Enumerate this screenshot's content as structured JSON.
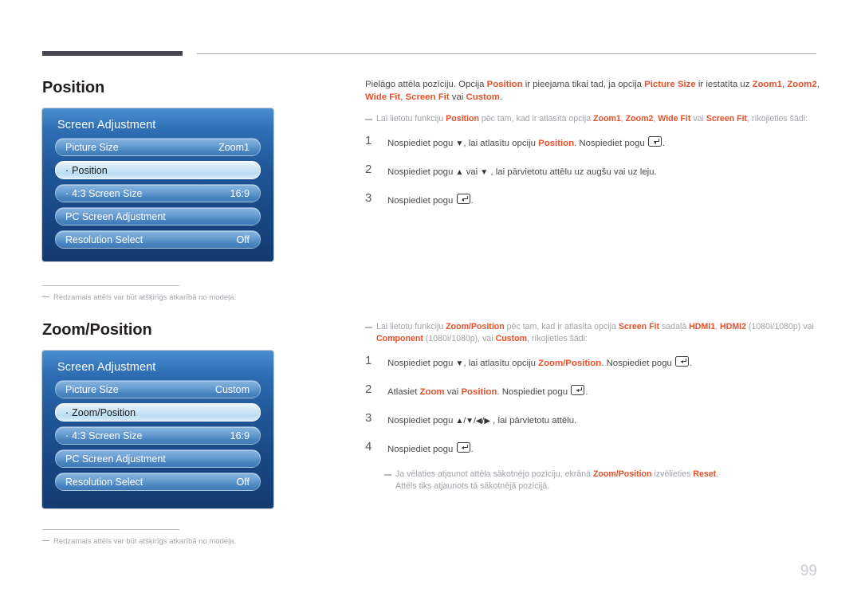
{
  "page": {
    "number": "99"
  },
  "sections": [
    {
      "id": "position",
      "title": "Position",
      "osd": {
        "title": "Screen Adjustment",
        "rows": [
          {
            "label": "Picture Size",
            "value": "Zoom1",
            "selected": false,
            "bullet": false
          },
          {
            "label": "Position",
            "value": "",
            "selected": true,
            "bullet": true
          },
          {
            "label": "4:3 Screen Size",
            "value": "16:9",
            "selected": false,
            "bullet": true
          },
          {
            "label": "PC Screen Adjustment",
            "value": "",
            "selected": false,
            "bullet": false
          },
          {
            "label": "Resolution Select",
            "value": "Off",
            "selected": false,
            "bullet": false
          }
        ]
      },
      "footnote": "Redzamais attēls var būt atšķirīgs atkarībā no modeļa.",
      "intro_parts": [
        {
          "t": "Pielāgo attēla pozīciju. Opcija ",
          "hl": false
        },
        {
          "t": "Position",
          "hl": true
        },
        {
          "t": " ir pieejama tikai tad, ja opcija ",
          "hl": false
        },
        {
          "t": "Picture Size",
          "hl": true
        },
        {
          "t": " ir iestatīta uz ",
          "hl": false
        },
        {
          "t": "Zoom1",
          "hl": true
        },
        {
          "t": ", ",
          "hl": false
        },
        {
          "t": "Zoom2",
          "hl": true
        },
        {
          "t": ", ",
          "hl": false
        },
        {
          "t": "Wide Fit",
          "hl": true
        },
        {
          "t": ", ",
          "hl": false
        },
        {
          "t": "Screen Fit",
          "hl": true
        },
        {
          "t": " vai ",
          "hl": false
        },
        {
          "t": "Custom",
          "hl": true
        },
        {
          "t": ".",
          "hl": false
        }
      ],
      "note_parts": [
        {
          "t": "Lai lietotu funkciju ",
          "hl": false
        },
        {
          "t": "Position",
          "hl": true
        },
        {
          "t": " pēc tam, kad ir atlasīta opcija ",
          "hl": false
        },
        {
          "t": "Zoom1",
          "hl": true
        },
        {
          "t": ", ",
          "hl": false
        },
        {
          "t": "Zoom2",
          "hl": true
        },
        {
          "t": ", ",
          "hl": false
        },
        {
          "t": "Wide Fit",
          "hl": true
        },
        {
          "t": " vai ",
          "hl": false
        },
        {
          "t": "Screen Fit",
          "hl": true
        },
        {
          "t": ", rīkojieties šādi:",
          "hl": false
        }
      ],
      "steps": [
        {
          "num": "1",
          "parts": [
            {
              "t": "Nospiediet pogu ",
              "k": "text"
            },
            {
              "t": "▼",
              "k": "arrow"
            },
            {
              "t": ", lai atlasītu opciju ",
              "k": "text"
            },
            {
              "t": "Position",
              "k": "hl"
            },
            {
              "t": ". Nospiediet pogu ",
              "k": "text"
            },
            {
              "t": "enter-key",
              "k": "enter"
            },
            {
              "t": ".",
              "k": "text"
            }
          ]
        },
        {
          "num": "2",
          "parts": [
            {
              "t": "Nospiediet pogu ",
              "k": "text"
            },
            {
              "t": "▲",
              "k": "arrow"
            },
            {
              "t": " vai ",
              "k": "text"
            },
            {
              "t": "▼",
              "k": "arrow"
            },
            {
              "t": " , lai pārvietotu attēlu uz augšu vai uz leju.",
              "k": "text"
            }
          ]
        },
        {
          "num": "3",
          "parts": [
            {
              "t": "Nospiediet pogu ",
              "k": "text"
            },
            {
              "t": "enter-key",
              "k": "enter"
            },
            {
              "t": ".",
              "k": "text"
            }
          ]
        }
      ]
    },
    {
      "id": "zoom-position",
      "title": "Zoom/Position",
      "osd": {
        "title": "Screen Adjustment",
        "rows": [
          {
            "label": "Picture Size",
            "value": "Custom",
            "selected": false,
            "bullet": false
          },
          {
            "label": "Zoom/Position",
            "value": "",
            "selected": true,
            "bullet": true
          },
          {
            "label": "4:3 Screen Size",
            "value": "16:9",
            "selected": false,
            "bullet": true
          },
          {
            "label": "PC Screen Adjustment",
            "value": "",
            "selected": false,
            "bullet": false
          },
          {
            "label": "Resolution Select",
            "value": "Off",
            "selected": false,
            "bullet": false
          }
        ]
      },
      "footnote": "Redzamais attēls var būt atšķirīgs atkarībā no modeļa.",
      "note_parts": [
        {
          "t": "Lai lietotu funkciju ",
          "hl": false
        },
        {
          "t": "Zoom/Position",
          "hl": true
        },
        {
          "t": " pēc tam, kad ir atlasīta opcija ",
          "hl": false
        },
        {
          "t": "Screen Fit",
          "hl": true
        },
        {
          "t": " sadaļā ",
          "hl": false
        },
        {
          "t": "HDMI1",
          "hl": true
        },
        {
          "t": ", ",
          "hl": false
        },
        {
          "t": "HDMI2",
          "hl": true
        },
        {
          "t": " (1080i/1080p) vai ",
          "hl": false
        },
        {
          "t": "Component",
          "hl": true
        },
        {
          "t": " (1080i/1080p), vai ",
          "hl": false
        },
        {
          "t": "Custom",
          "hl": true
        },
        {
          "t": ", rīkojieties šādi:",
          "hl": false
        }
      ],
      "steps": [
        {
          "num": "1",
          "parts": [
            {
              "t": "Nospiediet pogu ",
              "k": "text"
            },
            {
              "t": "▼",
              "k": "arrow"
            },
            {
              "t": ", lai atlasītu opciju ",
              "k": "text"
            },
            {
              "t": "Zoom/Position",
              "k": "hl"
            },
            {
              "t": ". Nospiediet pogu ",
              "k": "text"
            },
            {
              "t": "enter-key",
              "k": "enter"
            },
            {
              "t": ".",
              "k": "text"
            }
          ]
        },
        {
          "num": "2",
          "parts": [
            {
              "t": "Atlasiet ",
              "k": "text"
            },
            {
              "t": "Zoom",
              "k": "hl"
            },
            {
              "t": " vai ",
              "k": "text"
            },
            {
              "t": "Position",
              "k": "hl"
            },
            {
              "t": ". Nospiediet pogu ",
              "k": "text"
            },
            {
              "t": "enter-key",
              "k": "enter"
            },
            {
              "t": ".",
              "k": "text"
            }
          ]
        },
        {
          "num": "3",
          "parts": [
            {
              "t": "Nospiediet pogu ",
              "k": "text"
            },
            {
              "t": "▲/▼/◀/▶",
              "k": "arrow"
            },
            {
              "t": " , lai pārvietotu attēlu.",
              "k": "text"
            }
          ]
        },
        {
          "num": "4",
          "parts": [
            {
              "t": "Nospiediet pogu ",
              "k": "text"
            },
            {
              "t": "enter-key",
              "k": "enter"
            },
            {
              "t": ".",
              "k": "text"
            }
          ]
        }
      ],
      "reset_note_parts": [
        {
          "t": "Ja vēlaties atjaunot attēla sākotnējo pozīciju, ekrānā ",
          "hl": false
        },
        {
          "t": "Zoom/Position",
          "hl": true
        },
        {
          "t": " izvēlieties ",
          "hl": false
        },
        {
          "t": "Reset",
          "hl": true
        },
        {
          "t": ".",
          "hl": false
        }
      ],
      "reset_note_line2": "Attēls tiks atjaunots tā sākotnējā pozīcijā."
    }
  ],
  "colors": {
    "highlight": "#e8502a",
    "body_text": "#4a4a4a",
    "note_text": "#9fa2a7",
    "osd_blue_dark": "#133b71",
    "osd_blue_light": "#4a8fd0",
    "rule_dark": "#46444e"
  }
}
